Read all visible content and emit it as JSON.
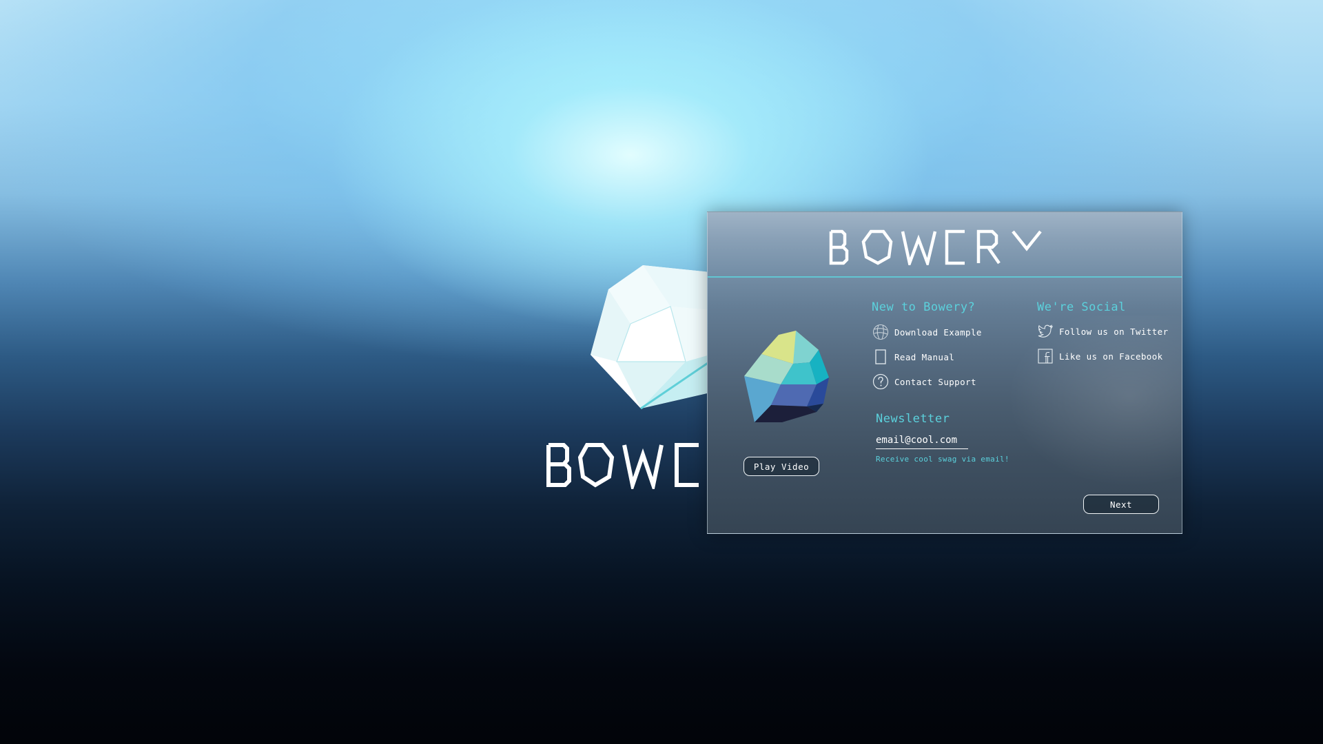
{
  "brand": {
    "background_wordmark": "BOWE",
    "header_wordmark": "BOWERY"
  },
  "dialog": {
    "play_button_label": "Play Video",
    "new_section": {
      "title": "New to Bowery?",
      "links": [
        {
          "icon": "globe-icon",
          "label": "Download Example"
        },
        {
          "icon": "book-icon",
          "label": "Read Manual"
        },
        {
          "icon": "question-icon",
          "label": "Contact Support"
        }
      ]
    },
    "social_section": {
      "title": "We're Social",
      "links": [
        {
          "icon": "twitter-icon",
          "label": "Follow us on Twitter"
        },
        {
          "icon": "facebook-icon",
          "label": "Like us on Facebook"
        }
      ]
    },
    "newsletter": {
      "title": "Newsletter",
      "email_value": "email@cool.com",
      "subtitle": "Receive cool swag via email!"
    },
    "next_button_label": "Next"
  },
  "colors": {
    "accent": "#5bd1dc",
    "button_border": "#f2f6f8"
  }
}
